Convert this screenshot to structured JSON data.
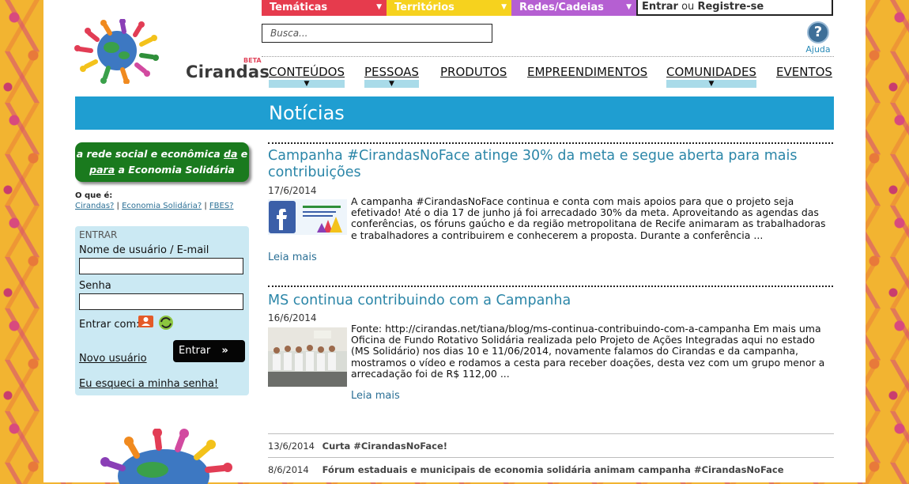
{
  "top_bar": {
    "tematicas": "Temáticas",
    "territorios": "Territórios",
    "redes": "Redes/Cadeias",
    "login_text": "Entrar",
    "login_or": "ou",
    "register_text": "Registre-se",
    "arrow": "▼"
  },
  "search": {
    "placeholder": "Busca..."
  },
  "help": {
    "label": "Ajuda",
    "glyph": "?"
  },
  "logo": {
    "name": "Cirandas",
    "badge": "BETA"
  },
  "nav": {
    "items": [
      "CONTEÚDOS",
      "PESSOAS",
      "PRODUTOS",
      "EMPREENDIMENTOS",
      "COMUNIDADES",
      "EVENTOS"
    ],
    "dropdown_glyph": "▼"
  },
  "banner": {
    "title": "Notícias"
  },
  "sidebar": {
    "slogan_1": "a rede social e econômica",
    "slogan_da": "da",
    "slogan_e": "e",
    "slogan_para": "para",
    "slogan_2": "a Economia Solidária",
    "oque_title": "O que é:",
    "oque_links": [
      "Cirandas?",
      "Economia Solidária?",
      "FBES?"
    ],
    "link_sep": "|",
    "login": {
      "header": "ENTRAR",
      "user_label": "Nome de usuário / E-mail",
      "user_value": "",
      "pass_label": "Senha",
      "pass_value": "",
      "social_label": "Entrar com:",
      "submit": "Entrar",
      "submit_glyph": "»",
      "new_user": "Novo usuário",
      "forgot": "Eu esqueci a minha senha!"
    }
  },
  "posts": [
    {
      "title": "Campanha #CirandasNoFace atinge 30% da meta e segue aberta para mais contribuições",
      "date": "17/6/2014",
      "body": "A campanha #CirandasNoFace continua e conta com mais apoios para que o projeto seja efetivado! Até o dia 17 de junho já foi arrecadado 30% da meta. Aproveitando as agendas das conferências, os fóruns gaúcho e da região metropolitana de Recife animaram as trabalhadoras e trabalhadores a contribuirem e conhecerem a proposta. Durante a conferência ...",
      "more": "Leia mais"
    },
    {
      "title": "MS continua contribuindo com a Campanha",
      "date": "16/6/2014",
      "body": "Fonte: http://cirandas.net/tiana/blog/ms-continua-contribuindo-com-a-campanha Em mais uma Oficina de Fundo Rotativo Solidária realizada pelo Projeto de Ações Integradas aqui no estado (MS Solidário) nos dias 10 e 11/06/2014, novamente falamos do Cirandas e da campanha, mostramos o vídeo e rodamos a cesta para receber doações, desta vez com um grupo menor a arrecadação foi de R$ 112,00 ...",
      "more": "Leia mais"
    }
  ],
  "news_list": [
    {
      "date": "13/6/2014",
      "title": "Curta #CirandasNoFace!"
    },
    {
      "date": "8/6/2014",
      "title": "Fórum estaduais e municipais de economia solidária animam campanha #CirandasNoFace"
    }
  ],
  "colors": {
    "tematicas": "#e63b4d",
    "territorios": "#f6d21e",
    "redes": "#b55fd2",
    "banner": "#1f9ed1",
    "slogan_bg": "#1a7a1e",
    "login_panel": "#cbe9f3",
    "title_link": "#2b86a8"
  }
}
